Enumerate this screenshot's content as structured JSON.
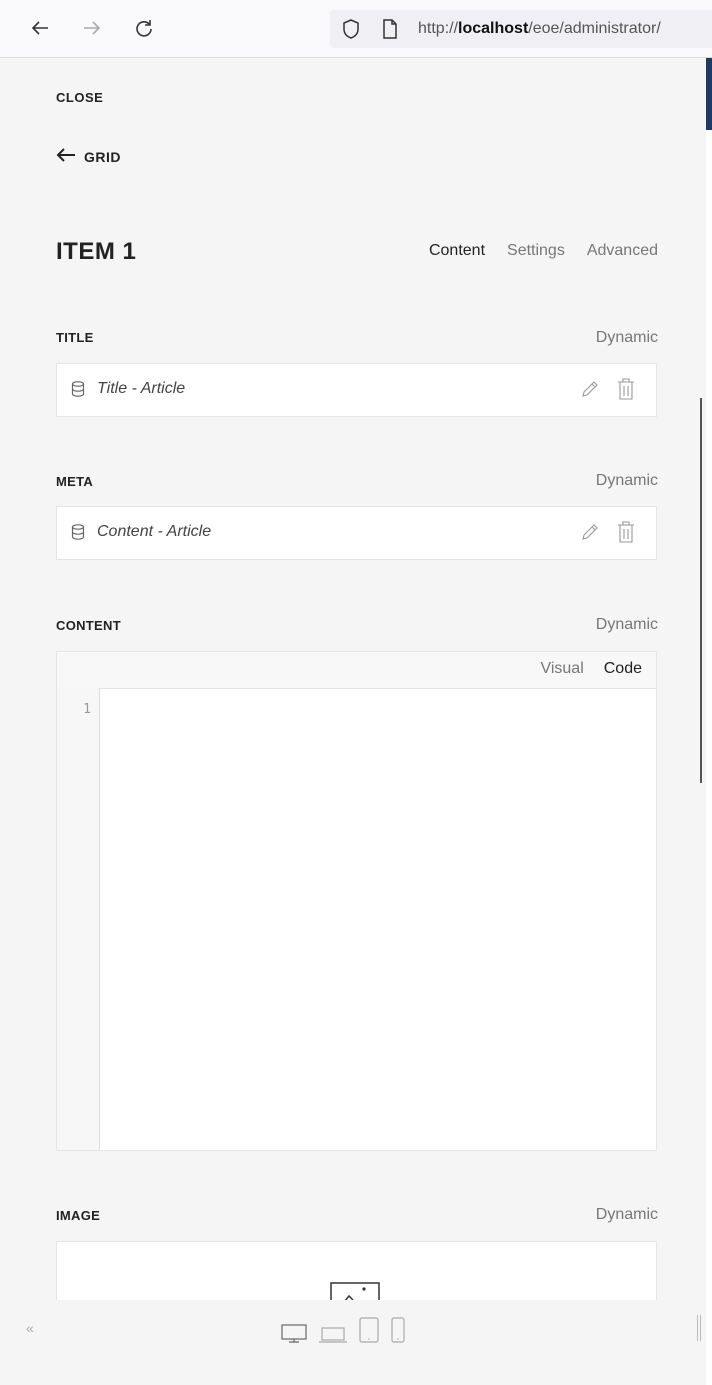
{
  "browser": {
    "url_prefix": "http://",
    "url_host": "localhost",
    "url_path": "/eoe/administrator/"
  },
  "panel": {
    "close_label": "CLOSE",
    "back_label": "GRID",
    "item_title": "ITEM 1",
    "tabs": [
      {
        "label": "Content",
        "active": true
      },
      {
        "label": "Settings",
        "active": false
      },
      {
        "label": "Advanced",
        "active": false
      }
    ],
    "fields": {
      "title": {
        "label": "TITLE",
        "dynamic_label": "Dynamic",
        "value": "Title - Article"
      },
      "meta": {
        "label": "META",
        "dynamic_label": "Dynamic",
        "value": "Content - Article"
      },
      "content": {
        "label": "CONTENT",
        "dynamic_label": "Dynamic",
        "editor_tabs": [
          {
            "label": "Visual",
            "active": false
          },
          {
            "label": "Code",
            "active": true
          }
        ],
        "line_numbers": [
          "1"
        ]
      },
      "image": {
        "label": "IMAGE",
        "dynamic_label": "Dynamic"
      }
    }
  },
  "bottom_bar": {
    "collapse_glyph": "«"
  },
  "colors": {
    "accent": "#1e3a6a",
    "panel_bg": "#f5f5f5",
    "muted_text": "#777777"
  }
}
